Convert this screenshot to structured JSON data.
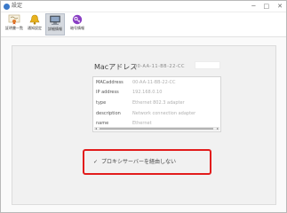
{
  "window": {
    "title": "設定",
    "minimize": "─",
    "maximize": "□",
    "close": "✕"
  },
  "toolbar": {
    "items": [
      {
        "label": "証明書一覧",
        "icon": "certificate-icon"
      },
      {
        "label": "通知設定",
        "icon": "bell-icon"
      },
      {
        "label": "詳細情報",
        "icon": "computer-icon"
      },
      {
        "label": "暗号情報",
        "icon": "key-icon"
      }
    ],
    "selected_index": 2
  },
  "network": {
    "mac_label": "Macアドレス",
    "mac_value": "00-AA-11-BB-22-CC",
    "rows": [
      {
        "key": "MACaddress",
        "value": "00-AA-11-BB-22-CC"
      },
      {
        "key": "IP address",
        "value": "192.168.0.10"
      },
      {
        "key": "type",
        "value": "Ethernet 802.3 adapter"
      },
      {
        "key": "description",
        "value": "Network connection adapter"
      },
      {
        "key": "name",
        "value": "Ethernet"
      }
    ],
    "scroll_left": "◂",
    "scroll_right": "▸"
  },
  "proxy": {
    "checked": true,
    "check_glyph": "✓",
    "label": "プロキシサーバーを経由しない"
  },
  "colors": {
    "highlight": "#e21c1c",
    "selected_tool": "#d5d9df"
  }
}
